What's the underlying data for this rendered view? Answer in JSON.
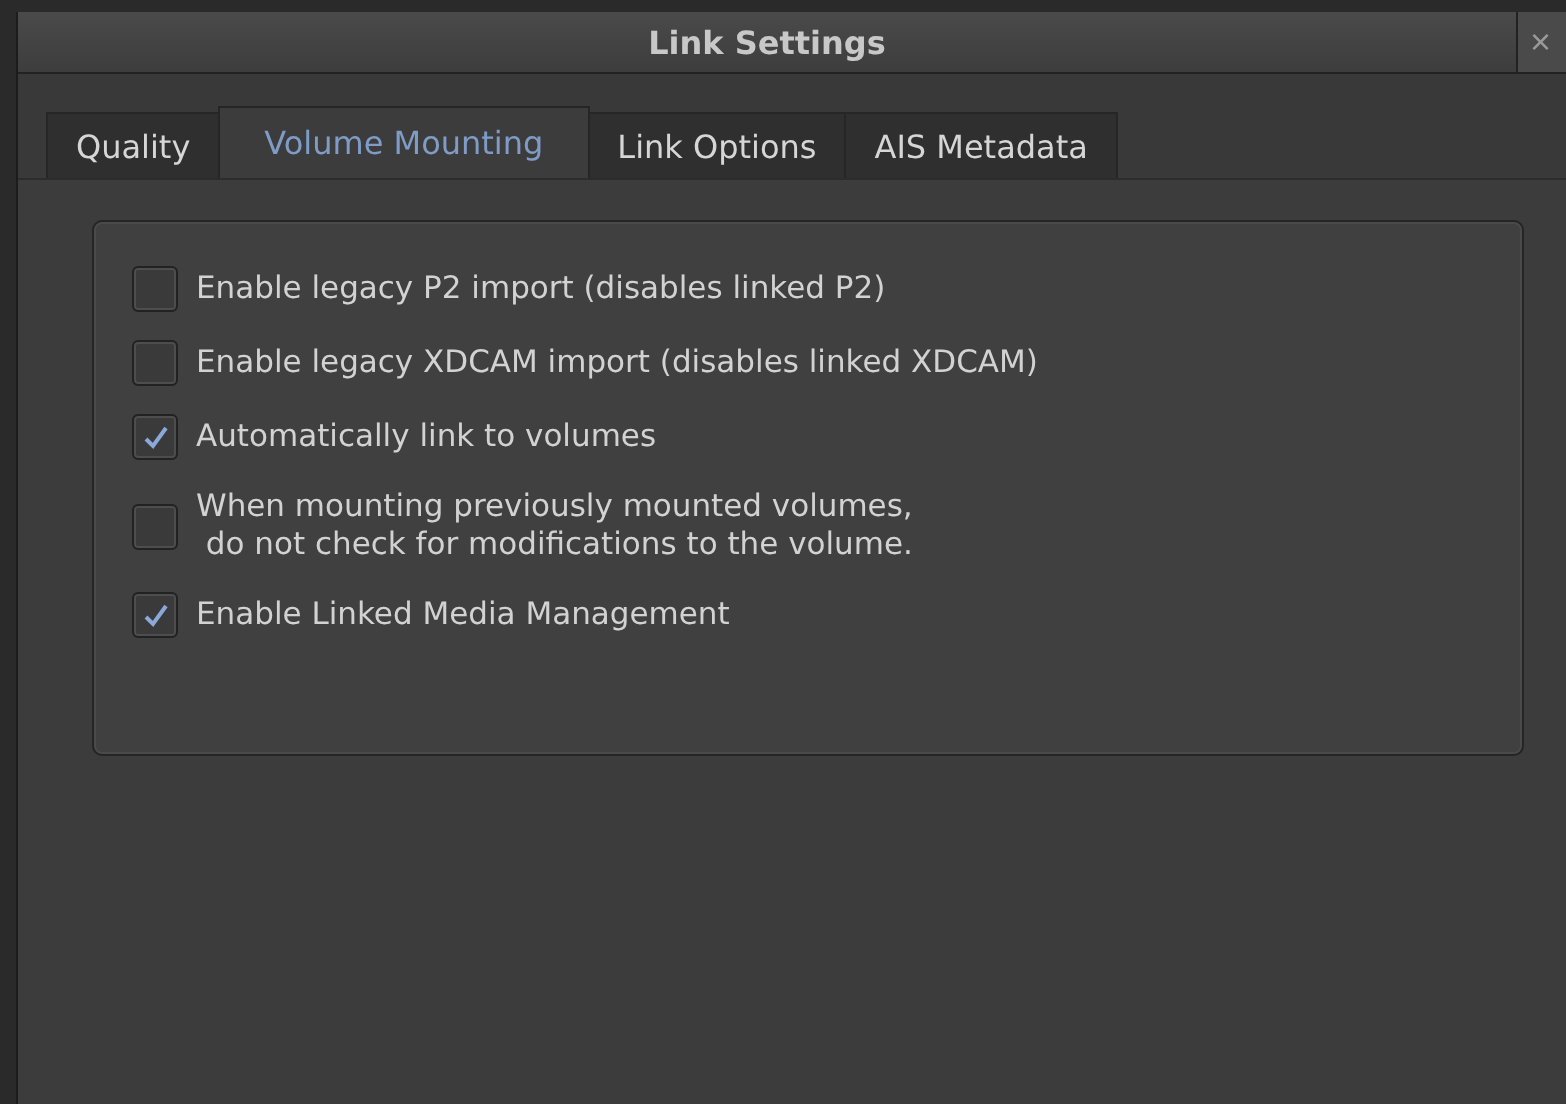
{
  "window": {
    "title": "Link Settings",
    "close": "×"
  },
  "tabs": [
    {
      "label": "Quality",
      "selected": false
    },
    {
      "label": "Volume Mounting",
      "selected": true
    },
    {
      "label": "Link Options",
      "selected": false
    },
    {
      "label": "AIS Metadata",
      "selected": false
    }
  ],
  "options": [
    {
      "label": "Enable legacy P2 import (disables linked P2)",
      "checked": false
    },
    {
      "label": "Enable legacy XDCAM import (disables linked XDCAM)",
      "checked": false
    },
    {
      "label": "Automatically link to volumes",
      "checked": true
    },
    {
      "label": "When mounting previously mounted volumes,\n do not check for modifications to the volume.",
      "checked": false
    },
    {
      "label": "Enable Linked Media Management",
      "checked": true
    }
  ]
}
